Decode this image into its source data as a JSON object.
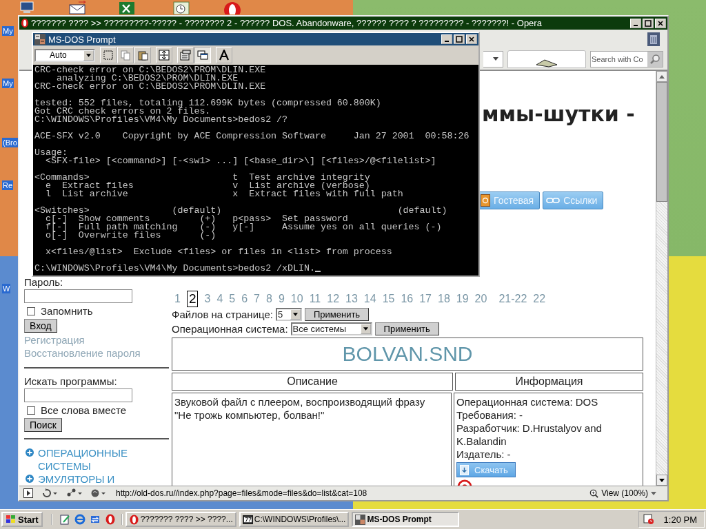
{
  "desktop_labels": [
    {
      "label": "My"
    },
    {
      "label": "My"
    },
    {
      "label": "(Bro"
    },
    {
      "label": "Re"
    },
    {
      "label": "W"
    }
  ],
  "browser": {
    "title": "??????? ???? >> ?????????-????? - ???????? 2 - ?????? DOS. Abandonware, ?????? ???? ? ????????? - ???????! - Opera",
    "search_placeholder": "Search with Co",
    "status_url": "http://old-dos.ru//index.php?page=files&mode=files&do=list&cat=108",
    "zoom": "View (100%)"
  },
  "page": {
    "heading": "ммы-шутки -",
    "nav_buttons": [
      {
        "label": "Гостевая",
        "kind": "guestbook"
      },
      {
        "label": "Ссылки",
        "kind": "links"
      }
    ],
    "login": {
      "password_label": "Пароль:",
      "remember": {
        "label": "Запомнить",
        "checked": false
      },
      "submit": "Вход",
      "links": [
        "Регистрация",
        "Восстановление пароля"
      ]
    },
    "search": {
      "label": "Искать программы:",
      "all_words": {
        "label": "Все слова вместе",
        "checked": false
      },
      "submit": "Поиск"
    },
    "categories": [
      "ОПЕРАЦИОННЫЕ СИСТЕМЫ",
      "ЭМУЛЯТОРЫ И"
    ],
    "pagination": [
      {
        "label": "1",
        "selected": false
      },
      {
        "label": "2",
        "selected": true
      },
      {
        "label": "3",
        "selected": false
      },
      {
        "label": "4",
        "selected": false
      },
      {
        "label": "5",
        "selected": false
      },
      {
        "label": "6",
        "selected": false
      },
      {
        "label": "7",
        "selected": false
      },
      {
        "label": "8",
        "selected": false
      },
      {
        "label": "9",
        "selected": false
      },
      {
        "label": "10",
        "selected": false
      },
      {
        "label": "11",
        "selected": false
      },
      {
        "label": "12",
        "selected": false
      },
      {
        "label": "13",
        "selected": false
      },
      {
        "label": "14",
        "selected": false
      },
      {
        "label": "15",
        "selected": false
      },
      {
        "label": "16",
        "selected": false
      },
      {
        "label": "17",
        "selected": false
      },
      {
        "label": "18",
        "selected": false
      },
      {
        "label": "19",
        "selected": false
      },
      {
        "label": "20",
        "selected": false
      },
      {
        "label": "21-22",
        "selected": false
      },
      {
        "label": "22",
        "selected": false
      }
    ],
    "per_page": {
      "label": "Файлов на странице:",
      "value": "5",
      "button": "Применить"
    },
    "os_filter": {
      "label": "Операционная система:",
      "value": "Все системы",
      "button": "Применить"
    },
    "file": {
      "title": "BOLVAN.SND",
      "columns": [
        "Описание",
        "Информация"
      ],
      "description": "Звуковой файл с плеером, воспроизводящий фразу \"Не трожь компьютер, болван!\"",
      "info": [
        "Операционная система: DOS",
        "Требования: -",
        "Разработчик: D.Hrustalyov and K.Balandin",
        "Издатель: -"
      ],
      "download": "Скачать"
    }
  },
  "dos": {
    "title": "MS-DOS Prompt",
    "font_size": "Auto",
    "blocks": [
      [
        "CRC-check error on C:\\BEDOS2\\PROM\\DLIN.EXE",
        "    analyzing C:\\BEDOS2\\PROM\\DLIN.EXE",
        "CRC-check error on C:\\BEDOS2\\PROM\\DLIN.EXE"
      ],
      [
        "tested: 552 files, totaling 112.699K bytes (compressed 60.800K)",
        "Got CRC check errors on 2 files.",
        "C:\\WINDOWS\\Profiles\\VM4\\My Documents>bedos2 /?"
      ],
      [
        "ACE-SFX v2.0    Copyright by ACE Compression Software     Jan 27 2001  00:58:26"
      ],
      [
        "Usage:",
        "  <SFX-file> [<command>] [-<sw1> ...] [<base_dir>\\] [<files>/@<filelist>]"
      ],
      [
        "<Commands>                          t  Test archive integrity",
        "  e  Extract files                  v  List archive (verbose)",
        "  l  List archive                   x  Extract files with full path"
      ],
      [
        "<Switches>               (default)                                (default)",
        "  c[-]  Show comments         (+)   p<pass>  Set password",
        "  f[-]  Full path matching    (-)   y[-]     Assume yes on all queries (-)",
        "  o[-]  Overwrite files       (-)"
      ],
      [
        "  x<files/@list>  Exclude <files> or files in <list> from process"
      ],
      [
        "C:\\WINDOWS\\Profiles\\VM4\\My Documents>bedos2 /xDLIN."
      ]
    ]
  },
  "taskbar": {
    "start": "Start",
    "tasks": [
      {
        "label": "??????? ???? >> ????...",
        "kind": "opera",
        "selected": false
      },
      {
        "label": "C:\\WINDOWS\\Profiles\\...",
        "kind": "archive",
        "selected": false
      },
      {
        "label": "MS-DOS Prompt",
        "kind": "dos",
        "selected": true
      }
    ],
    "clock": "1:20 PM"
  }
}
